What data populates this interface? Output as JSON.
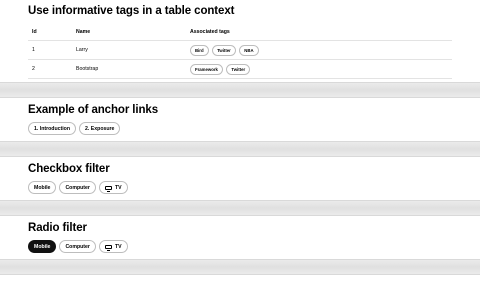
{
  "table_section": {
    "title": "Use informative tags in a table context",
    "columns": [
      "Id",
      "Name",
      "Associated tags"
    ],
    "rows": [
      {
        "id": "1",
        "name": "Larry",
        "tags": [
          "Bird",
          "Twitter",
          "NBA"
        ]
      },
      {
        "id": "2",
        "name": "Bootstrap",
        "tags": [
          "Framework",
          "Twitter"
        ]
      }
    ]
  },
  "anchor_section": {
    "title": "Example of anchor links",
    "links": [
      "1. Introduction",
      "2. Exposure"
    ]
  },
  "checkbox_section": {
    "title": "Checkbox filter",
    "options": [
      "Mobile",
      "Computer",
      "TV"
    ],
    "tv_icon": "tv-icon"
  },
  "radio_section": {
    "title": "Radio filter",
    "options": [
      "Mobile",
      "Computer",
      "TV"
    ],
    "selected": "Mobile",
    "tv_icon": "tv-icon"
  },
  "colors": {
    "selected_bg": "#111111",
    "divider": "#e5e5e5",
    "border": "#bdbdbd"
  }
}
